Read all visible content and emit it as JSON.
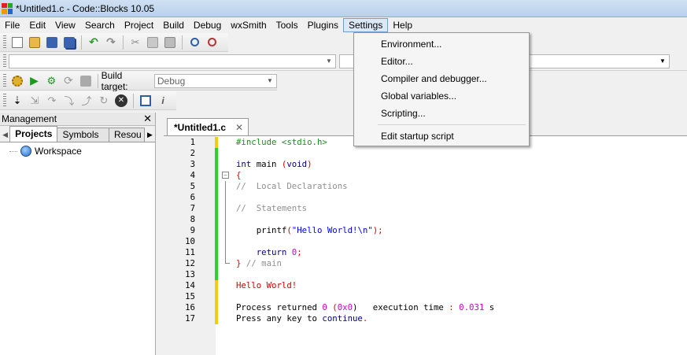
{
  "window": {
    "title": "*Untitled1.c - Code::Blocks 10.05"
  },
  "menubar": [
    "File",
    "Edit",
    "View",
    "Search",
    "Project",
    "Build",
    "Debug",
    "wxSmith",
    "Tools",
    "Plugins",
    "Settings",
    "Help"
  ],
  "settings_menu": {
    "items": [
      "Environment...",
      "Editor...",
      "Compiler and debugger...",
      "Global variables...",
      "Scripting..."
    ],
    "extra_item": "Edit startup script"
  },
  "build_toolbar": {
    "target_label": "Build target:",
    "target_value": "Debug"
  },
  "management": {
    "title": "Management",
    "close": "✕",
    "tabs": [
      "Projects",
      "Symbols",
      "Resou"
    ],
    "workspace": "Workspace"
  },
  "editor": {
    "tab_label": "*Untitled1.c",
    "tab_close": "✕",
    "line_numbers": [
      "1",
      "2",
      "3",
      "4",
      "5",
      "6",
      "7",
      "8",
      "9",
      "10",
      "11",
      "12",
      "13",
      "14",
      "15",
      "16",
      "17"
    ],
    "code": {
      "l1": "#include <stdio.h>",
      "l3_kw": "int",
      "l3_main": " main ",
      "l3_paren": "(",
      "l3_void": "void",
      "l3_close": ")",
      "l4": "{",
      "l5": "//  Local Declarations",
      "l7": "//  Statements",
      "l9_fn": "    printf",
      "l9_open": "(",
      "l9_str": "\"Hello World!\\n\"",
      "l9_close": ");",
      "l11_kw": "    return",
      "l11_num": " 0",
      "l11_end": ";",
      "l12_brace": "}",
      "l12_comment": " // main",
      "l14": "Hello World!",
      "l16_a": "Process returned ",
      "l16_num": "0",
      "l16_b": " (",
      "l16_hex": "0x0",
      "l16_c": ")   execution time ",
      "l16_colon": ":",
      "l16_time": " 0.031",
      "l16_s": " s",
      "l17_a": "Press any key to ",
      "l17_kw": "continue",
      "l17_dot": "."
    }
  }
}
